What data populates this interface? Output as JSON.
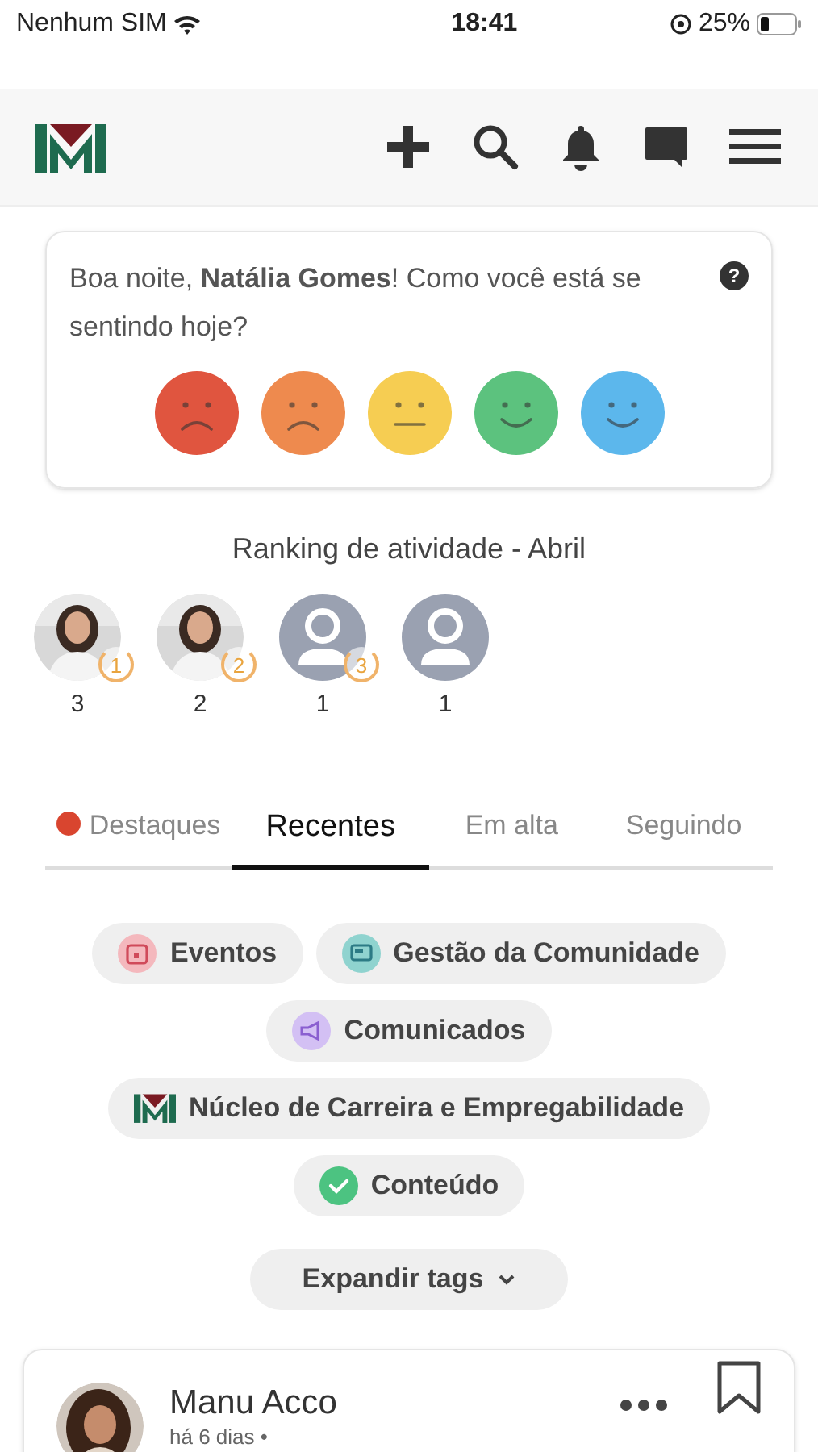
{
  "status_bar": {
    "carrier": "Nenhum SIM",
    "time": "18:41",
    "battery": "25%"
  },
  "greeting": {
    "text": "Boa noite, **Natália Gomes**! Como você está se sentindo hoje?",
    "help": "?",
    "moods": [
      {
        "kind": "sad",
        "color": "#e0553f"
      },
      {
        "kind": "sad",
        "color": "#ee8a4e"
      },
      {
        "kind": "neutral",
        "color": "#f6cd52"
      },
      {
        "kind": "happy",
        "color": "#5cc27e"
      },
      {
        "kind": "happy",
        "color": "#5cb7ec"
      }
    ]
  },
  "ranking": {
    "title": "Ranking de atividade - Abril",
    "users": [
      {
        "badge": "1",
        "count": "3"
      },
      {
        "badge": "2",
        "count": "2"
      },
      {
        "kind": "placeholder",
        "badge": "3",
        "count": "1"
      },
      {
        "kind": "placeholder",
        "count": "1"
      }
    ]
  },
  "tabs": [
    {
      "label": "Destaques",
      "selected": false,
      "dot": true
    },
    {
      "label": "Recentes",
      "selected": true,
      "dot": false
    },
    {
      "label": "Em alta",
      "selected": false,
      "dot": false
    },
    {
      "label": "Seguindo",
      "selected": false,
      "dot": false
    }
  ],
  "tags": [
    {
      "label": "Eventos",
      "kind": "calendar"
    },
    {
      "label": "Gestão da Comunidade",
      "kind": "screen"
    },
    {
      "label": "Comunicados",
      "kind": "megaphone"
    },
    {
      "label": "Núcleo de Carreira e Empregabilidade",
      "kind": "logo"
    },
    {
      "label": "Conteúdo",
      "kind": "check"
    }
  ],
  "expand_button": "Expandir tags",
  "post": {
    "author": "Manu Acco",
    "time": "há 6 dias •"
  }
}
